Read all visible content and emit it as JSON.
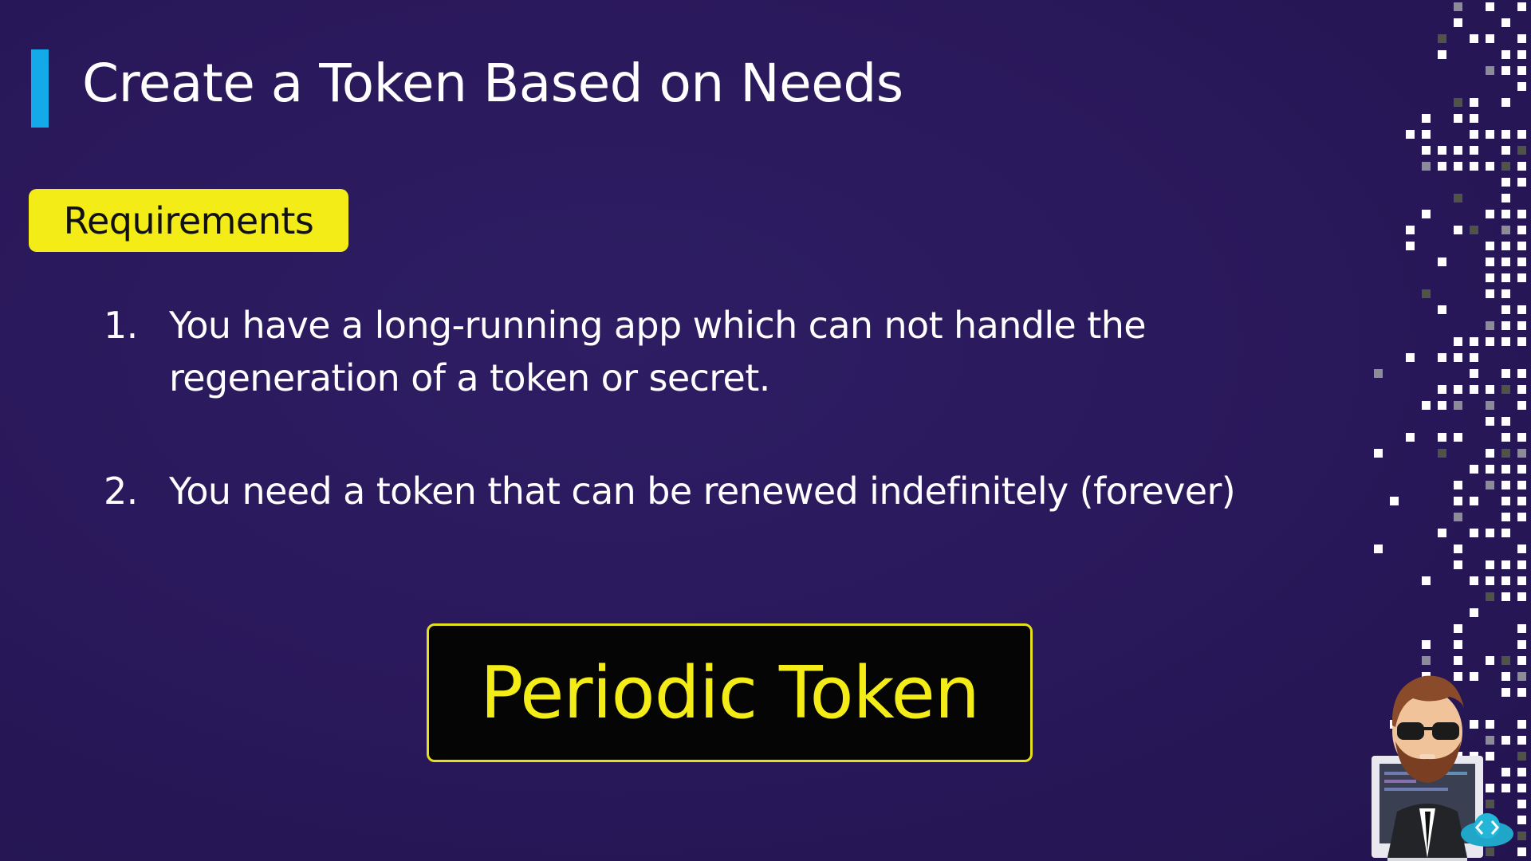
{
  "slide": {
    "title": "Create a Token Based on Needs",
    "badge_label": "Requirements",
    "requirements": [
      {
        "number": "1.",
        "text": "You have a long-running app which can not handle the regeneration of a token or secret."
      },
      {
        "number": "2.",
        "text": "You need a token that can be renewed indefinitely (forever)"
      }
    ],
    "answer": "Periodic Token"
  },
  "colors": {
    "background": "#29185a",
    "accent_bar": "#14a9e8",
    "badge_yellow": "#f3ec16",
    "answer_text": "#f3ec16",
    "answer_box": "#050505"
  },
  "decor": {
    "pixel_pattern_icon": "pixel-grid-icon",
    "presenter_icon": "presenter-avatar-icon",
    "logo_icon": "cloud-code-logo-icon"
  }
}
